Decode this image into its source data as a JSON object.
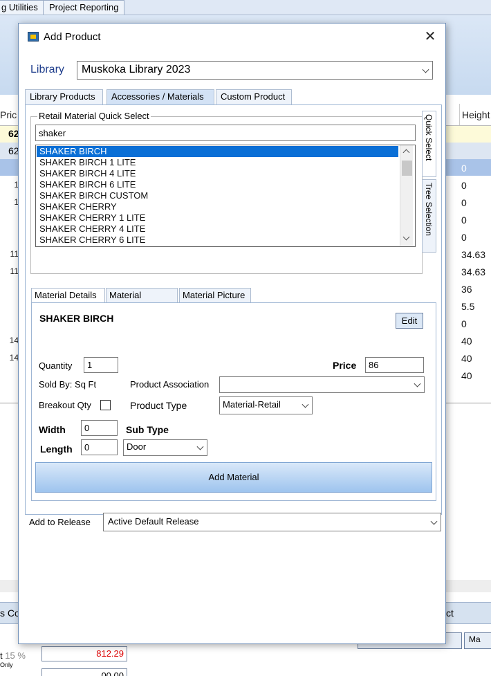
{
  "background": {
    "tabs": [
      "g Utilities",
      "Project Reporting"
    ],
    "columns": {
      "price": "Pric",
      "height": "Height"
    },
    "row_yellow": "62",
    "row_blue": "62",
    "left_values": [
      "1",
      "1",
      "",
      "",
      "11",
      "11",
      "",
      "",
      "",
      "14",
      "14"
    ],
    "height_values": [
      "0",
      "0",
      "0",
      "0",
      "0",
      "34.63",
      "34.63",
      "36",
      "5.5",
      "0",
      "40",
      "40",
      "40"
    ],
    "bottom_left": "s Cos",
    "bottom_right": "ct",
    "pct_label": "t",
    "pct_value": "15 %",
    "only_label": "Only",
    "amount": "812.29",
    "amount2": "00.00",
    "btn_ma": "Ma"
  },
  "dialog": {
    "title": "Add Product",
    "library_label": "Library",
    "library_value": "Muskoka Library 2023",
    "tabs": [
      "Library Products",
      "Accessories / Materials",
      "Custom Product"
    ],
    "quick_select": {
      "legend": "Retail Material Quick Select",
      "search_value": "shaker",
      "items": [
        "SHAKER BIRCH",
        "SHAKER BIRCH 1 LITE",
        "SHAKER BIRCH 4 LITE",
        "SHAKER BIRCH 6 LITE",
        "SHAKER BIRCH CUSTOM",
        "SHAKER CHERRY",
        "SHAKER CHERRY 1 LITE",
        "SHAKER CHERRY 4 LITE",
        "SHAKER CHERRY 6 LITE"
      ],
      "selected_index": 0
    },
    "side_tabs": [
      "Quick Select",
      "Tree Selection"
    ],
    "detail_tabs": [
      "Material Details",
      "Material Options",
      "Material Picture"
    ],
    "details": {
      "material_name": "SHAKER BIRCH",
      "edit_label": "Edit",
      "quantity_label": "Quantity",
      "quantity_value": "1",
      "price_label": "Price",
      "price_value": "86",
      "sold_by": "Sold By: Sq Ft",
      "product_association_label": "Product Association",
      "product_association_value": "",
      "breakout_label": "Breakout Qty",
      "product_type_label": "Product Type",
      "product_type_value": "Material-Retail",
      "width_label": "Width",
      "width_value": "0",
      "length_label": "Length",
      "length_value": "0",
      "sub_type_label": "Sub Type",
      "sub_type_value": "Door",
      "add_material_label": "Add Material"
    },
    "release_label": "Add to Release",
    "release_value": "Active Default Release"
  }
}
